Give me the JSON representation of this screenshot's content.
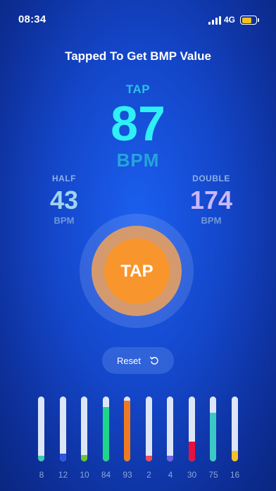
{
  "status_bar": {
    "time": "08:34",
    "network": "4G",
    "battery_level": 0.75,
    "battery_color": "#f7c21b"
  },
  "title": "Tapped To Get BMP Value",
  "tap": {
    "label": "TAP",
    "value": "87",
    "unit": "BPM"
  },
  "half": {
    "label": "HALF",
    "value": "43",
    "unit": "BPM"
  },
  "double": {
    "label": "DOUBLE",
    "value": "174",
    "unit": "BPM"
  },
  "tap_button": {
    "label": "TAP",
    "color": "#f8952c"
  },
  "reset": {
    "label": "Reset",
    "icon": "reset-icon"
  },
  "history": {
    "max": 100,
    "items": [
      {
        "value": 8,
        "label": "8",
        "color": "#3dc9b4"
      },
      {
        "value": 12,
        "label": "12",
        "color": "#2d57e0"
      },
      {
        "value": 10,
        "label": "10",
        "color": "#6cc62a"
      },
      {
        "value": 84,
        "label": "84",
        "color": "#1ed68a"
      },
      {
        "value": 93,
        "label": "93",
        "color": "#f07a1f"
      },
      {
        "value": 2,
        "label": "2",
        "color": "#f04a5b"
      },
      {
        "value": 4,
        "label": "4",
        "color": "#6d63e6"
      },
      {
        "value": 30,
        "label": "30",
        "color": "#e8103f"
      },
      {
        "value": 75,
        "label": "75",
        "color": "#3cc8c4"
      },
      {
        "value": 16,
        "label": "16",
        "color": "#f6c02a"
      }
    ]
  }
}
